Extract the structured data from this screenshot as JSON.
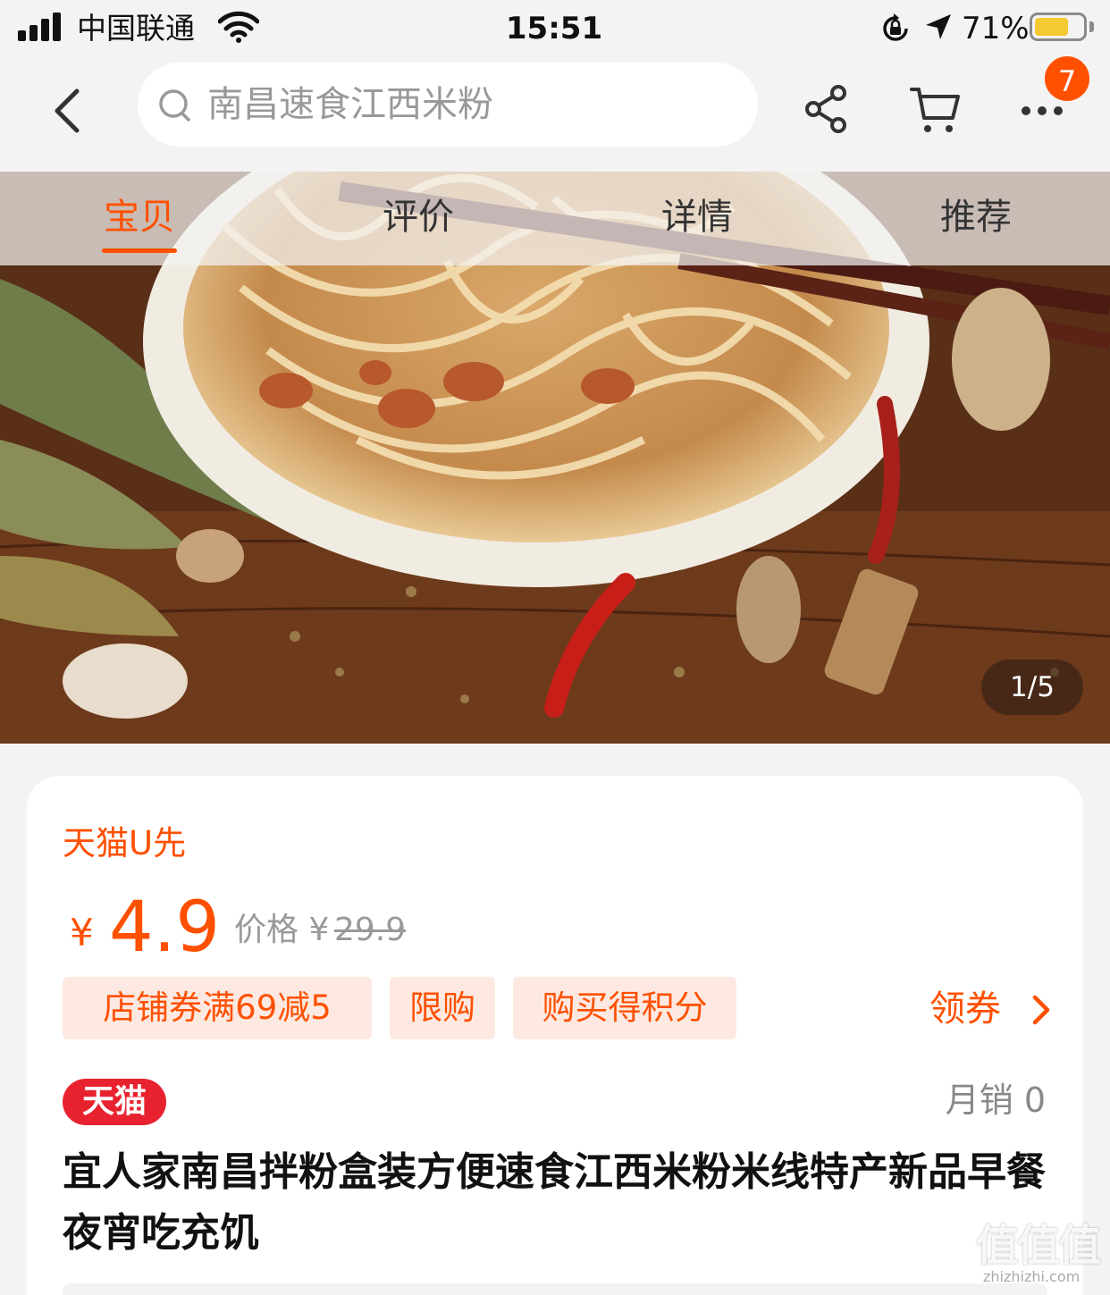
{
  "status_bar": {
    "carrier": "中国联通",
    "time": "15:51",
    "battery_percent": "71%",
    "battery_level": 0.71,
    "icons": [
      "signal-icon",
      "wifi-icon",
      "rotation-lock-icon",
      "location-arrow-icon",
      "battery-icon"
    ]
  },
  "nav": {
    "search_placeholder": "南昌速食江西米粉",
    "cart_badge": "7",
    "icons": [
      "back-icon",
      "search-icon",
      "share-icon",
      "cart-icon",
      "more-icon"
    ]
  },
  "tabs": [
    {
      "label": "宝贝",
      "active": true
    },
    {
      "label": "评价",
      "active": false
    },
    {
      "label": "详情",
      "active": false
    },
    {
      "label": "推荐",
      "active": false
    }
  ],
  "gallery": {
    "pager": "1/5"
  },
  "product": {
    "brand_label": "天猫U先",
    "currency": "¥",
    "price": "4.9",
    "original_price_label": "价格 ¥",
    "original_price_value": "29.9",
    "tags": [
      "店铺券满69减5",
      "限购",
      "购买得积分"
    ],
    "coupon_link": "领券",
    "platform_badge": "天猫",
    "monthly_sales": "月销 0",
    "title": "宜人家南昌拌粉盒装方便速食江西米粉米线特产新品早餐夜宵吃充饥"
  },
  "watermark": {
    "glyphs": "值值值",
    "domain": "zhizhizhi.com"
  },
  "colors": {
    "accent": "#ff5000",
    "tmall_red": "#e8232f",
    "tag_bg": "#fde9e1",
    "background": "#f3f3f3"
  }
}
